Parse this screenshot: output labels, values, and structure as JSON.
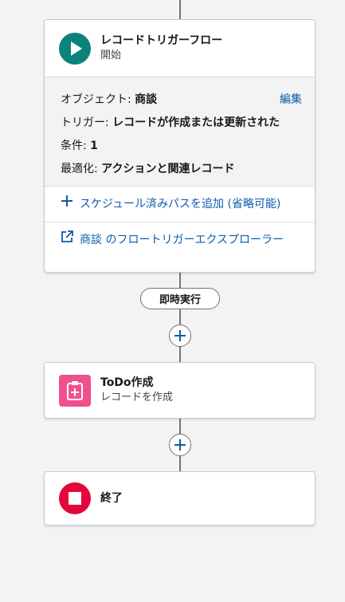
{
  "start_node": {
    "title": "レコードトリガーフロー",
    "subtitle": "開始",
    "edit_label": "編集",
    "object_label": "オブジェクト:",
    "object_value": "商談",
    "trigger_label": "トリガー:",
    "trigger_value": "レコードが作成または更新された",
    "condition_label": "条件:",
    "condition_value": "1",
    "optimize_label": "最適化:",
    "optimize_value": "アクションと関連レコード",
    "add_path_label": "スケジュール済みパスを追加 (省略可能)",
    "explore_label": "商談 のフロートリガーエクスプローラー"
  },
  "path_pill": {
    "label": "即時実行"
  },
  "todo_node": {
    "title": "ToDo作成",
    "subtitle": "レコードを作成"
  },
  "end_node": {
    "title": "終了"
  },
  "colors": {
    "start_icon_bg": "#0b827c",
    "todo_icon_bg": "#f0508d",
    "end_icon_bg": "#e3063b",
    "link": "#0b5cab",
    "connector": "#747474"
  },
  "icons": {
    "start": "play-icon",
    "todo": "clipboard-plus-icon",
    "end": "stop-icon",
    "add": "plus-icon",
    "explore": "external-link-icon"
  }
}
